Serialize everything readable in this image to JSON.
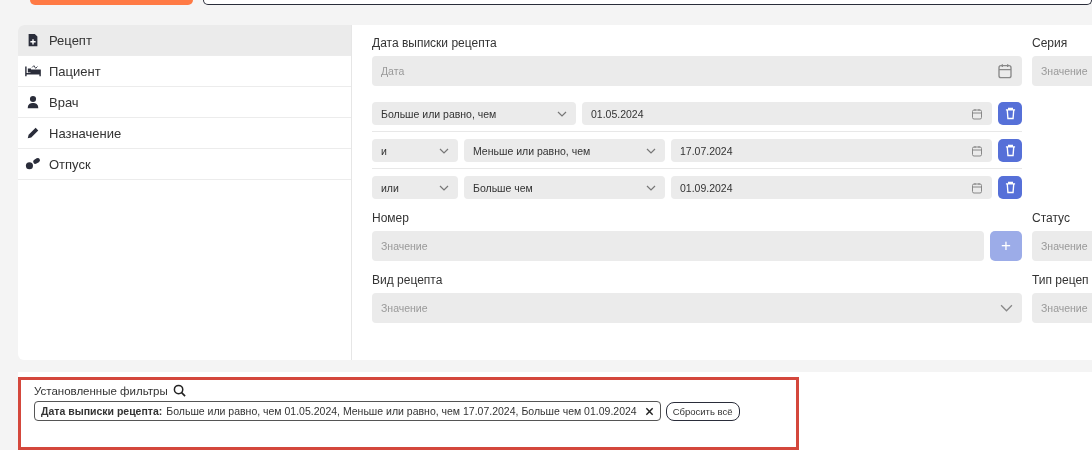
{
  "sidebar": {
    "items": [
      {
        "label": "Рецепт",
        "kind": "document",
        "selected": true
      },
      {
        "label": "Пациент",
        "kind": "bed",
        "selected": false
      },
      {
        "label": "Врач",
        "kind": "doctor",
        "selected": false
      },
      {
        "label": "Назначение",
        "kind": "pencil",
        "selected": false
      },
      {
        "label": "Отпуск",
        "kind": "pills",
        "selected": false
      }
    ]
  },
  "date_filter": {
    "label": "Дата выписки рецепта",
    "placeholder": "Дата",
    "conditions": [
      {
        "operator": "Больше или равно, чем",
        "value": "01.05.2024"
      },
      {
        "conjunction": "и",
        "operator": "Меньше или равно, чем",
        "value": "17.07.2024"
      },
      {
        "conjunction": "или",
        "operator": "Больше чем",
        "value": "01.09.2024"
      }
    ]
  },
  "series": {
    "label": "Серия",
    "placeholder": "Значение"
  },
  "number": {
    "label": "Номер",
    "placeholder": "Значение",
    "add_button": "+"
  },
  "status": {
    "label": "Статус",
    "placeholder": "Значение"
  },
  "recipe_kind": {
    "label": "Вид рецепта",
    "placeholder": "Значение"
  },
  "recipe_type": {
    "label": "Тип рецеп",
    "placeholder": "Значение"
  },
  "applied_filters": {
    "title": "Установленные фильтры",
    "chips": [
      {
        "label": "Дата выписки рецепта:",
        "value": "Больше или равно, чем 01.05.2024, Меньше или равно, чем 17.07.2024, Больше чем 01.09.2024"
      }
    ],
    "reset_button": "Сбросить всё"
  }
}
